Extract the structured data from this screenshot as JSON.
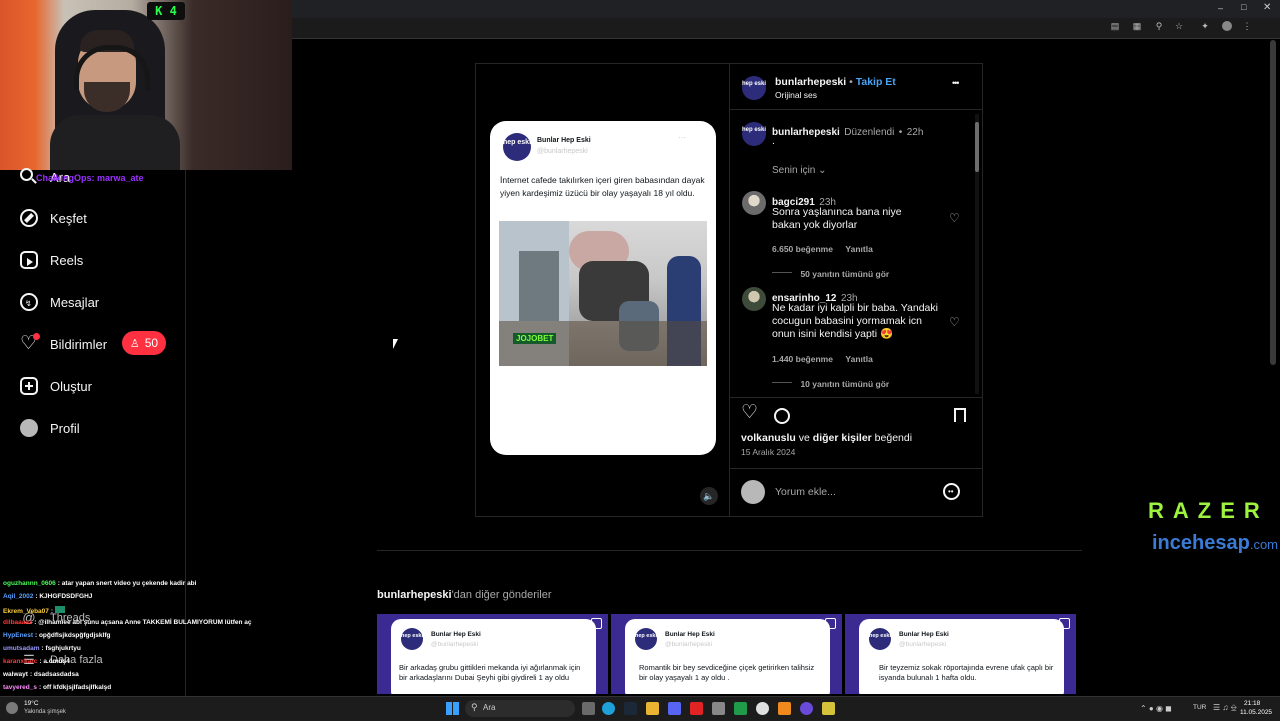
{
  "webcam": {
    "badge": "4"
  },
  "overlay_users": [
    {
      "text": "ChalkingOps: marwa_ate",
      "color": "#9b30ff"
    }
  ],
  "sidebar": {
    "items": [
      {
        "label": "Ara",
        "icon": "search-icon"
      },
      {
        "label": "Keşfet",
        "icon": "compass-icon"
      },
      {
        "label": "Reels",
        "icon": "reels-icon"
      },
      {
        "label": "Mesajlar",
        "icon": "messenger-icon"
      },
      {
        "label": "Bildirimler",
        "icon": "heart-icon"
      },
      {
        "label": "Oluştur",
        "icon": "plus-square-icon"
      },
      {
        "label": "Profil",
        "icon": "profile-avatar"
      }
    ],
    "threads_label": "Threads",
    "more_label": "Daha fazla",
    "notification_badge": "50"
  },
  "chat": [
    {
      "user": "oguzhannn_0606",
      "user_color": "#4cff5a",
      "msg": ": atar yapan snert video yu çekende kadir abi"
    },
    {
      "user": "Aqil_2002",
      "user_color": "#5aa0ff",
      "msg": ": KJHGFDSDFGHJ"
    },
    {
      "user": "Ekrem_Veba07",
      "user_color": "#ffd23a",
      "msg": ":"
    },
    {
      "user": "dilbaaaaz",
      "user_color": "#ff3b3b",
      "msg": ": @ilhamiee abi şunu açsana Anne TAKKEMİ BULAMIYORUM lütfen aç"
    },
    {
      "user": "HypEnest",
      "user_color": "#5aa0ff",
      "msg": ": opğdflsjkdspğfgdjsklfg"
    },
    {
      "user": "umutsadam",
      "user_color": "#9b9bff",
      "msg": ": fsghjukrtyu"
    },
    {
      "user": "karanxkarc",
      "user_color": "#ff3b3b",
      "msg": ": a.ömüş4"
    },
    {
      "user": "walwayt",
      "user_color": "#ffffff",
      "msg": ": dsadsasdadsa"
    },
    {
      "user": "tavyered_s",
      "user_color": "#ff8cff",
      "msg": ": off kfdkjsjlfadsjlfkalşd"
    }
  ],
  "post": {
    "header": {
      "username": "bunlarhepeski",
      "follow": "Takip Et",
      "sep": "•",
      "audio": "Orijinal ses",
      "more": "•••"
    },
    "avatar_text": "hep eski",
    "tweet": {
      "name": "Bunlar Hep Eski",
      "handle": "@bunlarhepeski",
      "text": "İnternet cafede takılırken içeri giren babasından dayak yiyen kardeşimiz üzücü bir olay yaşayalı 18 yıl oldu.",
      "watermark": "JOJOBET"
    },
    "caption": {
      "username": "bunlarhepeski",
      "edited": "Düzenlendi",
      "sep": "•",
      "time": "22h",
      "text": "."
    },
    "for_you": "Senin için",
    "comments": [
      {
        "user": "bagci291",
        "time": "23h",
        "text": "Sonra yaşlanınca bana niye bakan yok diyorlar",
        "likes": "6.650 beğenme",
        "reply": "Yanıtla",
        "view_replies": "50 yanıtın tümünü gör"
      },
      {
        "user": "ensarinho_12",
        "time": "23h",
        "text": "Ne kadar iyi kalpli bir baba. Yandaki cocugun babasini yormamak icn onun isini kendisi yapti 😍",
        "likes": "1.440 beğenme",
        "reply": "Yanıtla",
        "view_replies": "10 yanıtın tümünü gör"
      }
    ],
    "likes_line": {
      "user": "volkanuslu",
      "mid": "ve",
      "others": "diğer kişiler",
      "end": "beğendi"
    },
    "date": "15 Aralık 2024",
    "comment_placeholder": "Yorum ekle..."
  },
  "more_posts": {
    "title_user": "bunlarhepeski",
    "title_rest": "'dan diğer gönderiler",
    "items": [
      {
        "name": "Bunlar Hep Eski",
        "handle": "@bunlarhepeski",
        "text": "Bir arkadaş grubu gittikleri mekanda iyi ağırlanmak için bir arkadaşlarını Dubai Şeyhi gibi giydireli 1 ay oldu"
      },
      {
        "name": "Bunlar Hep Eski",
        "handle": "@bunlarhepeski",
        "text": "Romantik bir bey sevdiceğine çiçek getirirken talihsiz bir olay yaşayalı 1 ay oldu ."
      },
      {
        "name": "Bunlar Hep Eski",
        "handle": "@bunlarhepeski",
        "text": "Bir teyzemiz sokak röportajında evrene ufak çaplı bir isyanda bulunalı 1 hafta oldu."
      }
    ]
  },
  "sponsor": {
    "razer": "RAZER",
    "incehesap": "incehesap",
    "domain": ".com"
  },
  "taskbar": {
    "weather": "19°C",
    "weather_sub": "Yakında şimşek",
    "search": "Ara",
    "lang": "TUR",
    "time": "21:18",
    "date": "11.05.2025"
  }
}
